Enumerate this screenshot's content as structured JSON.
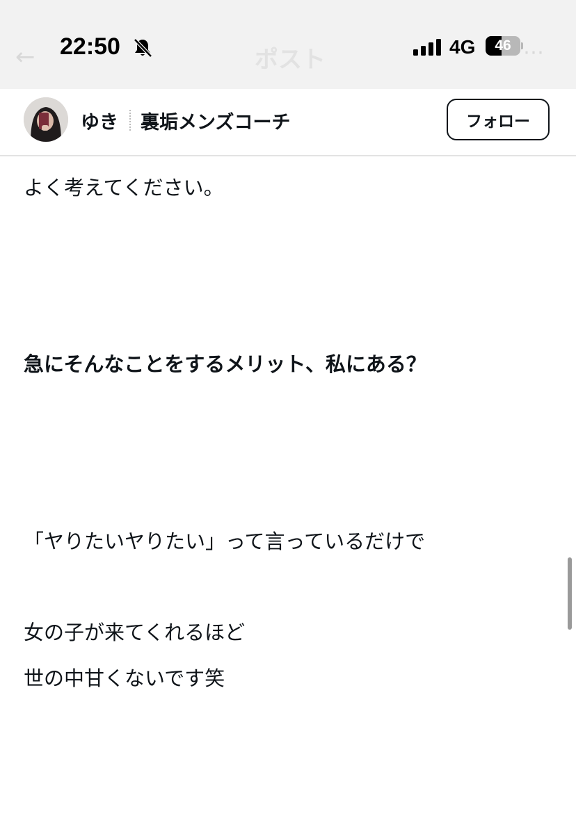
{
  "status_bar": {
    "time": "22:50",
    "network": "4G",
    "battery_level": "46",
    "battery_fraction": 0.46
  },
  "nav": {
    "title": "ポスト"
  },
  "author": {
    "name": "ゆき",
    "title": "裏垢メンズコーチ",
    "follow_label": "フォロー"
  },
  "article": {
    "paragraphs": [
      "よく考えてください。",
      "急にそんなことをするメリット、私にある？",
      "「ヤりたいヤりたい」って言っているだけで",
      "女の子が来てくれるほど",
      "世の中甘くないです笑"
    ]
  },
  "icons": {
    "back": "back-arrow-icon",
    "more": "more-icon",
    "bell": "bell-slash-icon",
    "signal": "cellular-signal-icon",
    "battery": "battery-icon"
  },
  "colors": {
    "text": "#0f1419",
    "status_bar_bg": "#f2f2f2",
    "divider": "#e3e3e3"
  }
}
